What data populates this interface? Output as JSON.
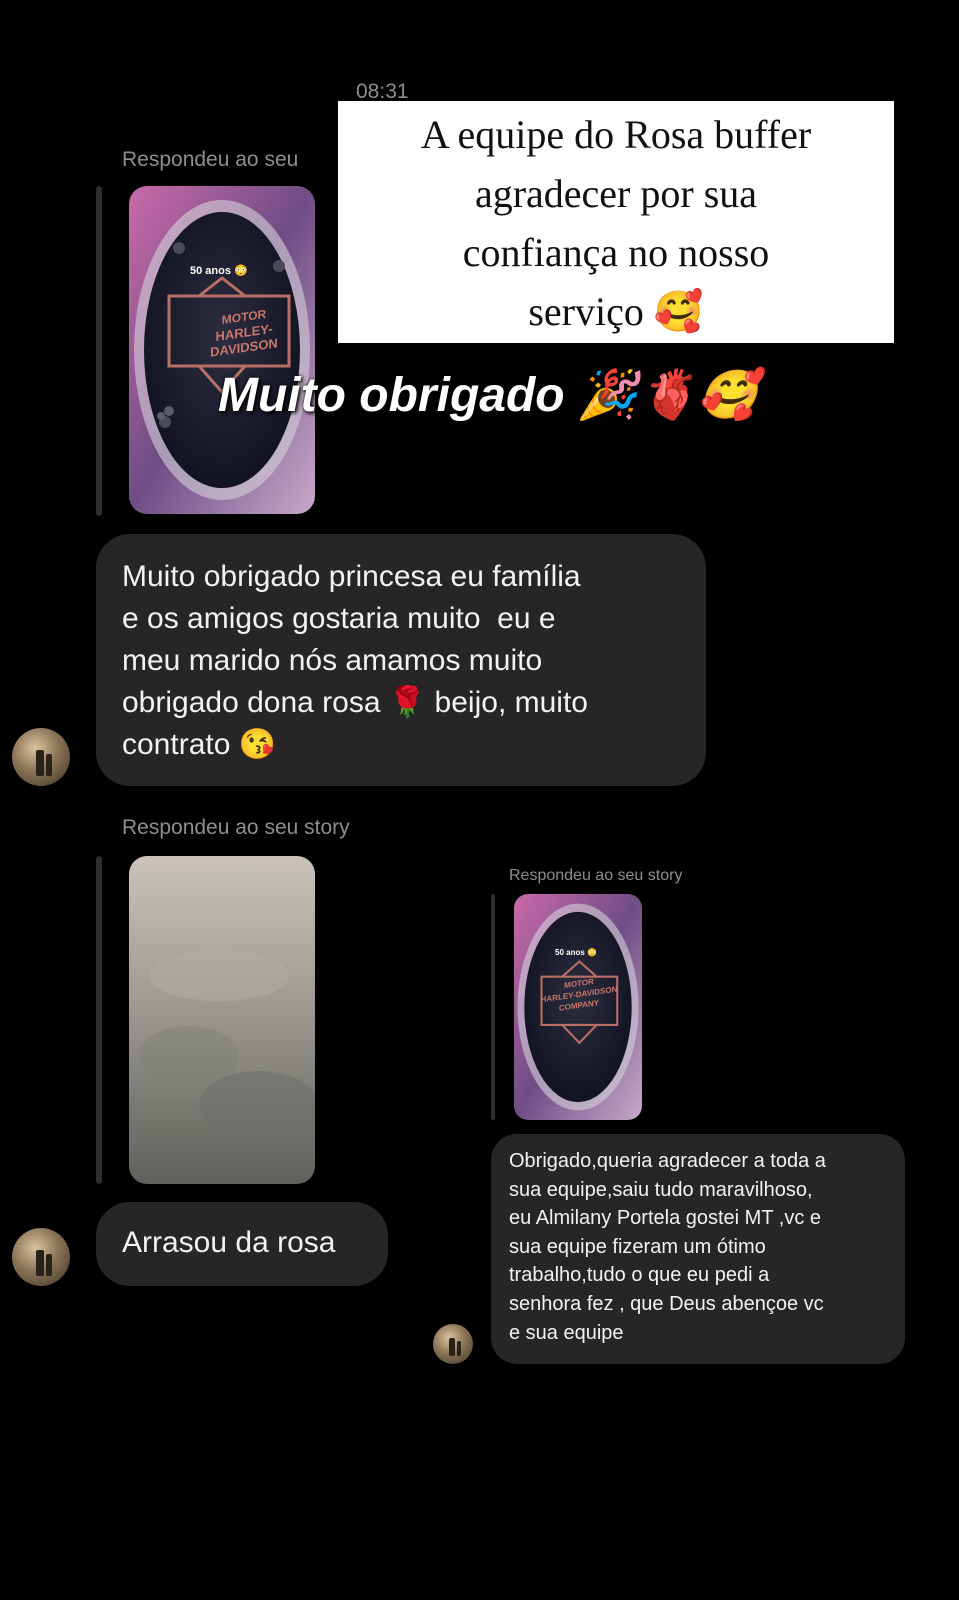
{
  "status": {
    "time": "08:31"
  },
  "overlay": {
    "caption_lines": [
      "A equipe do Rosa buffer",
      "agradecer por sua",
      "confiança no nosso",
      "serviço 🥰"
    ],
    "big_caption": "Muito obrigado 🎉🫀🥰"
  },
  "messages": {
    "first": {
      "replied_label": "Respondeu ao seu",
      "story_badge": "50 anos 😳",
      "text_lines": [
        "Muito obrigado princesa eu família",
        "e os amigos gostaria muito  eu e",
        "meu marido nós amamos muito",
        "obrigado dona rosa 🌹 beijo, muito",
        "contrato 😘"
      ]
    },
    "second": {
      "replied_label": "Respondeu ao seu story",
      "text": "Arrasou da rosa"
    },
    "third": {
      "replied_label": "Respondeu ao seu story",
      "story_badge": "50 anos 😳",
      "text_lines": [
        "Obrigado,queria agradecer a toda a",
        "sua equipe,saiu tudo maravilhoso,",
        "eu Almilany Portela gostei MT ,vc e",
        "sua equipe fizeram um ótimo",
        "trabalho,tudo o que eu pedi a",
        "senhora fez , que Deus abençoe vc",
        "e sua equipe"
      ]
    }
  },
  "logo": {
    "line1": "MOTOR",
    "line2": "HARLEY-DAVIDSON",
    "line3": "COMPANY"
  },
  "colors": {
    "background": "#000000",
    "bubble": "#262626",
    "muted_text": "#8e8e8e"
  }
}
